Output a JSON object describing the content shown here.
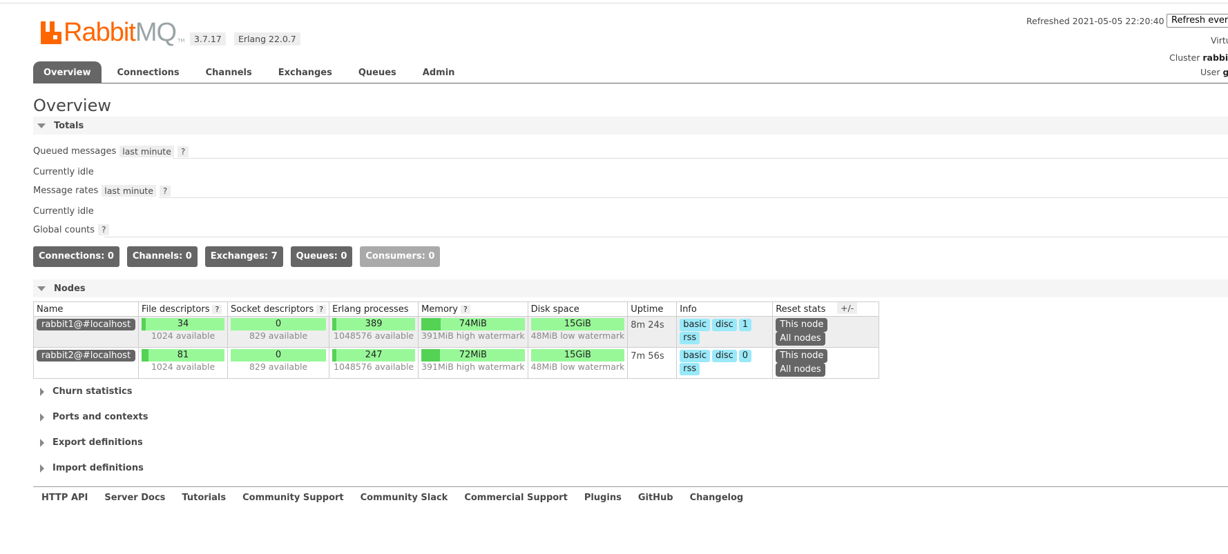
{
  "header": {
    "logo_text_rabbit": "Rabbit",
    "logo_text_mq": "MQ",
    "logo_tm": "TM",
    "version": "3.7.17",
    "erlang": "Erlang 22.0.7",
    "refreshed": "Refreshed 2021-05-05 22:20:40",
    "refresh_select": "Refresh every",
    "virtual_host_label": "Virtu",
    "cluster_label": "Cluster",
    "cluster_value": "rabbit",
    "user_label": "User",
    "user_value": "g"
  },
  "tabs": [
    "Overview",
    "Connections",
    "Channels",
    "Exchanges",
    "Queues",
    "Admin"
  ],
  "page_title": "Overview",
  "totals": {
    "section": "Totals",
    "queued_messages": "Queued messages",
    "queued_range": "last minute",
    "help": "?",
    "queued_idle": "Currently idle",
    "message_rates": "Message rates",
    "rates_range": "last minute",
    "rates_idle": "Currently idle",
    "global_counts": "Global counts"
  },
  "counts": [
    {
      "label": "Connections:",
      "value": "0"
    },
    {
      "label": "Channels:",
      "value": "0"
    },
    {
      "label": "Exchanges:",
      "value": "7"
    },
    {
      "label": "Queues:",
      "value": "0"
    },
    {
      "label": "Consumers:",
      "value": "0"
    }
  ],
  "nodes": {
    "section": "Nodes",
    "columns": [
      "Name",
      "File descriptors",
      "Socket descriptors",
      "Erlang processes",
      "Memory",
      "Disk space",
      "Uptime",
      "Info",
      "Reset stats"
    ],
    "plus_minus": "+/-",
    "rows": [
      {
        "name": "rabbit1@#localhost",
        "fd": "34",
        "fd_avail": "1024 available",
        "fd_fraction": 0.033,
        "sd": "0",
        "sd_avail": "829 available",
        "sd_fraction": 0,
        "ep": "389",
        "ep_avail": "1048576 available",
        "ep_fraction": 0.0004,
        "mem": "74MiB",
        "mem_sub": "391MiB high watermark",
        "mem_fraction": 0.19,
        "disk": "15GiB",
        "disk_sub": "48MiB low watermark",
        "disk_fraction": 0,
        "uptime": "8m 24s",
        "info": [
          "basic",
          "disc",
          "1",
          "rss"
        ],
        "reset": [
          "This node",
          "All nodes"
        ]
      },
      {
        "name": "rabbit2@#localhost",
        "fd": "81",
        "fd_avail": "1024 available",
        "fd_fraction": 0.079,
        "sd": "0",
        "sd_avail": "829 available",
        "sd_fraction": 0,
        "ep": "247",
        "ep_avail": "1048576 available",
        "ep_fraction": 0.0002,
        "mem": "72MiB",
        "mem_sub": "391MiB high watermark",
        "mem_fraction": 0.18,
        "disk": "15GiB",
        "disk_sub": "48MiB low watermark",
        "disk_fraction": 0,
        "uptime": "7m 56s",
        "info": [
          "basic",
          "disc",
          "0",
          "rss"
        ],
        "reset": [
          "This node",
          "All nodes"
        ]
      }
    ]
  },
  "collapsed_sections": [
    "Churn statistics",
    "Ports and contexts",
    "Export definitions",
    "Import definitions"
  ],
  "footer": [
    "HTTP API",
    "Server Docs",
    "Tutorials",
    "Community Support",
    "Community Slack",
    "Commercial Support",
    "Plugins",
    "GitHub",
    "Changelog"
  ],
  "colors": {
    "brand_orange": "#ff6600",
    "bar_green": "#98f898",
    "bar_green_fill": "#54d254",
    "info_blue": "#99e9f9",
    "tab_dark": "#666666"
  }
}
